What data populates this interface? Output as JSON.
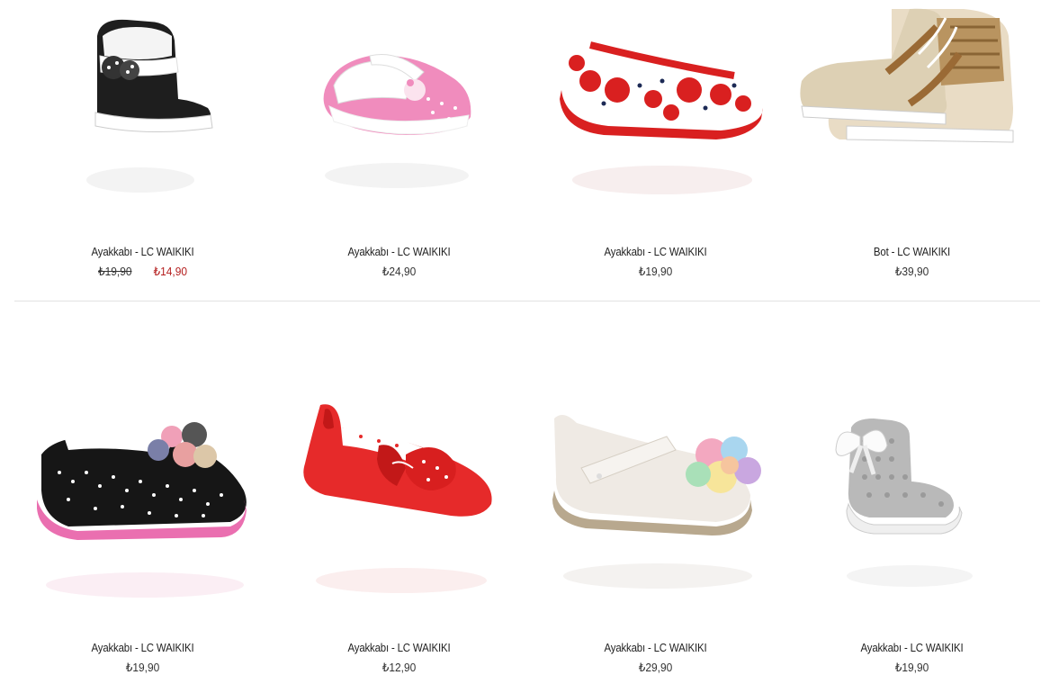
{
  "products": [
    {
      "name": "Ayakkabı - LC WAIKIKI",
      "old_price": "₺19,90",
      "price": "₺14,90",
      "image": "black-bow-bootie"
    },
    {
      "name": "Ayakkabı - LC WAIKIKI",
      "old_price": "",
      "price": "₺24,90",
      "image": "pink-polka-mary-jane"
    },
    {
      "name": "Ayakkabı - LC WAIKIKI",
      "old_price": "",
      "price": "₺19,90",
      "image": "red-poppy-flat"
    },
    {
      "name": "Bot - LC WAIKIKI",
      "old_price": "",
      "price": "₺39,90",
      "image": "gold-houndstooth-hightop"
    },
    {
      "name": "Ayakkabı - LC WAIKIKI",
      "old_price": "",
      "price": "₺19,90",
      "image": "black-dot-flower-flat"
    },
    {
      "name": "Ayakkabı - LC WAIKIKI",
      "old_price": "",
      "price": "₺12,90",
      "image": "red-bow-bootie"
    },
    {
      "name": "Ayakkabı - LC WAIKIKI",
      "old_price": "",
      "price": "₺29,90",
      "image": "white-flower-ballerina"
    },
    {
      "name": "Ayakkabı - LC WAIKIKI",
      "old_price": "",
      "price": "₺19,90",
      "image": "grey-knit-bootie"
    }
  ],
  "colors": {
    "sale": "#b41e1e",
    "separator": "#e2e2e2"
  }
}
